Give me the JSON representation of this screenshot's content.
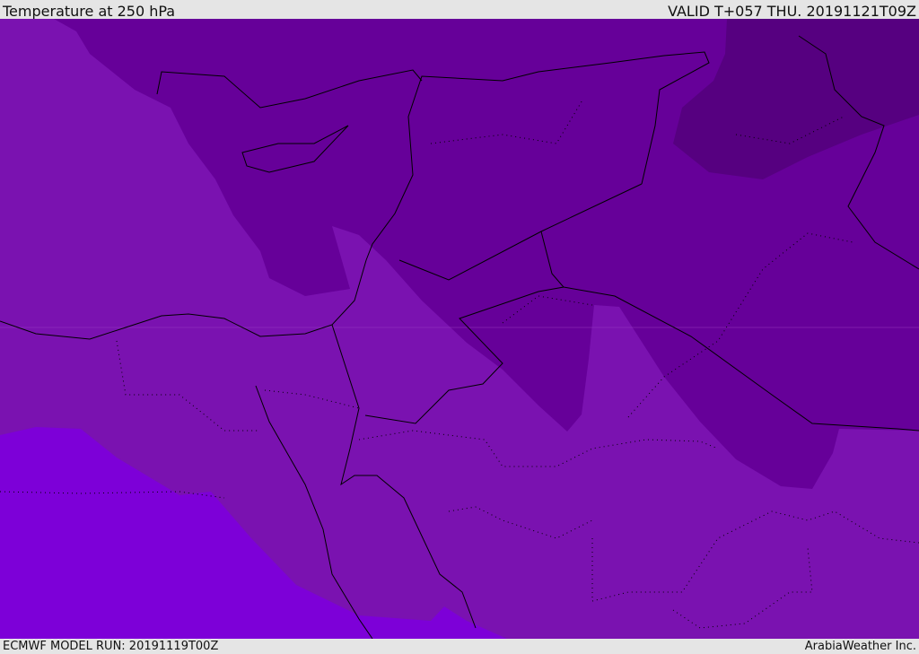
{
  "header": {
    "title": "Temperature at 250 hPa",
    "valid_time": "VALID T+057 THU. 20191121T09Z"
  },
  "footer": {
    "model_run": "ECMWF MODEL RUN: 20191119T00Z",
    "credit": "ArabiaWeather Inc."
  },
  "map": {
    "variable": "temperature",
    "level": "250 hPa",
    "colors": {
      "band_warm": "#7d00d8",
      "band_mid": "#7a12b0",
      "band_cool": "#660099",
      "band_cold": "#560080",
      "borders": "#000000"
    }
  }
}
